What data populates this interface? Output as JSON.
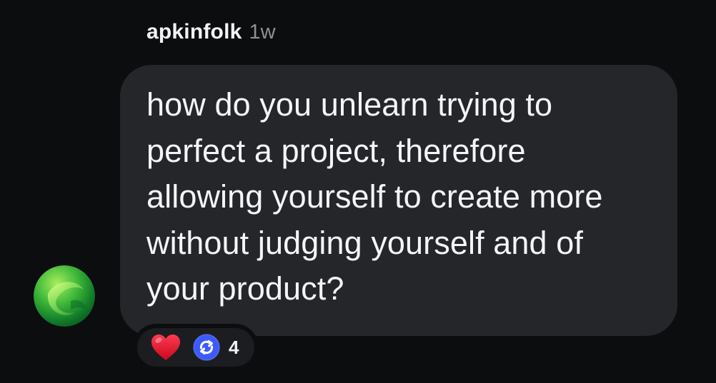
{
  "comment": {
    "username": "apkinfolk",
    "timestamp": "1w",
    "message_lines": [
      "how do you unlearn trying to",
      "perfect a project, therefore",
      "allowing yourself to create more",
      "without judging yourself and of",
      "your product?"
    ],
    "avatar_icon": "green-orb-avatar-icon",
    "reactions": {
      "heart_icon": "heart-icon",
      "restack_icon": "restack-icon",
      "count": "4"
    }
  },
  "colors": {
    "background": "#0c0d0f",
    "bubble": "#25262a",
    "text_primary": "#f4f5f7",
    "text_secondary": "#8e9096",
    "heart": "#e0122d",
    "restack": "#3d5afe"
  }
}
